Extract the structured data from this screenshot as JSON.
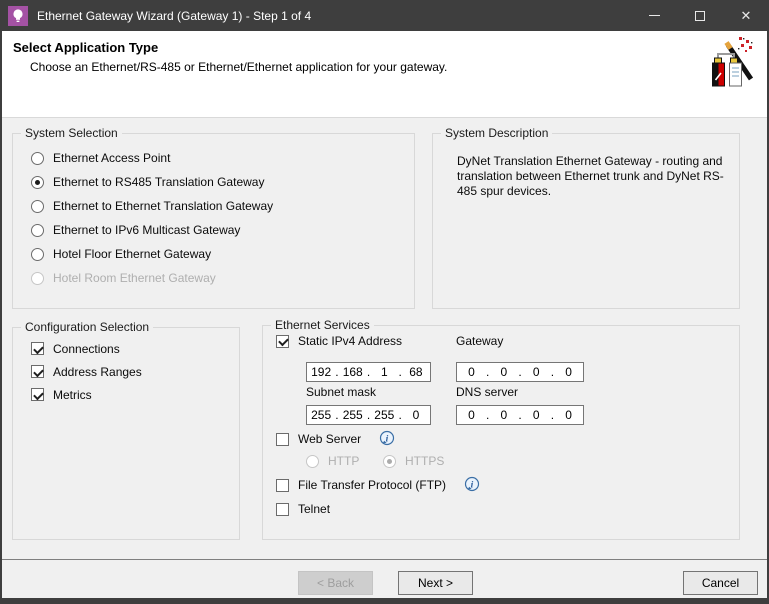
{
  "window": {
    "title": "Ethernet Gateway Wizard (Gateway 1) - Step 1 of 4",
    "close_glyph": "✕"
  },
  "header": {
    "title": "Select Application Type",
    "description": "Choose an Ethernet/RS-485 or Ethernet/Ethernet application for your gateway."
  },
  "system_selection": {
    "label": "System Selection",
    "options": [
      {
        "label": "Ethernet Access Point",
        "selected": false,
        "disabled": false
      },
      {
        "label": "Ethernet to RS485 Translation Gateway",
        "selected": true,
        "disabled": false
      },
      {
        "label": "Ethernet to Ethernet Translation Gateway",
        "selected": false,
        "disabled": false
      },
      {
        "label": "Ethernet to IPv6 Multicast Gateway",
        "selected": false,
        "disabled": false
      },
      {
        "label": "Hotel Floor Ethernet Gateway",
        "selected": false,
        "disabled": false
      },
      {
        "label": "Hotel Room Ethernet Gateway",
        "selected": false,
        "disabled": true
      }
    ]
  },
  "system_description": {
    "label": "System Description",
    "text": "DyNet Translation Ethernet Gateway - routing and translation between Ethernet trunk and DyNet RS-485 spur devices."
  },
  "configuration_selection": {
    "label": "Configuration Selection",
    "options": [
      {
        "label": "Connections",
        "checked": true
      },
      {
        "label": "Address Ranges",
        "checked": true
      },
      {
        "label": "Metrics",
        "checked": true
      }
    ]
  },
  "ethernet_services": {
    "label": "Ethernet Services",
    "ip_sep": ".",
    "static_ipv4": {
      "label": "Static IPv4 Address",
      "checked": true,
      "octets": [
        "192",
        "168",
        "1",
        "68"
      ]
    },
    "gateway": {
      "label": "Gateway",
      "octets": [
        "0",
        "0",
        "0",
        "0"
      ]
    },
    "subnet_mask": {
      "label": "Subnet mask",
      "octets": [
        "255",
        "255",
        "255",
        "0"
      ]
    },
    "dns_server": {
      "label": "DNS server",
      "octets": [
        "0",
        "0",
        "0",
        "0"
      ]
    },
    "web_server": {
      "label": "Web Server",
      "checked": false
    },
    "http": {
      "label": "HTTP",
      "selected": false,
      "disabled": true
    },
    "https": {
      "label": "HTTPS",
      "selected": true,
      "disabled": true
    },
    "ftp": {
      "label": "File Transfer Protocol (FTP)",
      "checked": false
    },
    "telnet": {
      "label": "Telnet",
      "checked": false
    }
  },
  "buttons": {
    "back": "< Back",
    "next": "Next >",
    "cancel": "Cancel"
  },
  "colors": {
    "titlebar": "#3E3E3E",
    "app_icon_purple": "#A452A4",
    "client_bg": "#F0F0F0",
    "info_blue": "#3A6EA5"
  }
}
